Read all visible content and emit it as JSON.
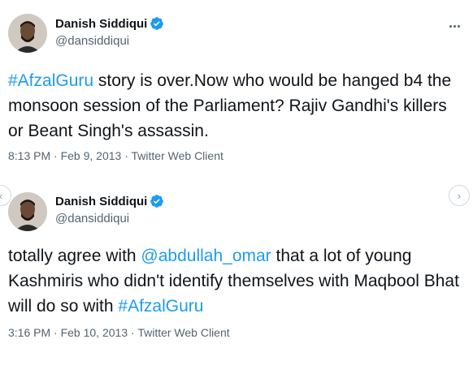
{
  "tweets": [
    {
      "display_name": "Danish Siddiqui",
      "handle": "@dansiddiqui",
      "text_parts": [
        {
          "kind": "hashtag",
          "text": "#AfzalGuru"
        },
        {
          "kind": "text",
          "text": " story is over.Now who would be hanged b4 the monsoon session of the Parliament? Rajiv Gandhi's killers or Beant Singh's assassin."
        }
      ],
      "time": "8:13 PM",
      "date": "Feb 9, 2013",
      "client": "Twitter Web Client"
    },
    {
      "display_name": "Danish Siddiqui",
      "handle": "@dansiddiqui",
      "text_parts": [
        {
          "kind": "text",
          "text": "totally agree with "
        },
        {
          "kind": "mention",
          "text": "@abdullah_omar"
        },
        {
          "kind": "text",
          "text": " that a lot of  young Kashmiris who didn't identify themselves with Maqbool Bhat will do so with "
        },
        {
          "kind": "hashtag",
          "text": "#AfzalGuru"
        }
      ],
      "time": "3:16 PM",
      "date": "Feb 10, 2013",
      "client": "Twitter Web Client"
    }
  ],
  "separator": " · ",
  "icons": {
    "verified": "verified-badge-icon",
    "more": "more-options-icon",
    "prev": "chevron-left-icon",
    "next": "chevron-right-icon"
  },
  "colors": {
    "link": "#1d9bf0",
    "text": "#0f1419",
    "muted": "#536471"
  }
}
